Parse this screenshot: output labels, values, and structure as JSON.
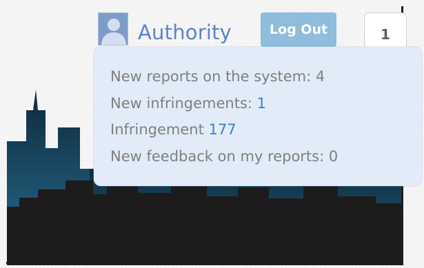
{
  "header": {
    "user_name": "Authority",
    "logout_label": "Log Out",
    "notification_count": "1"
  },
  "notifications": {
    "items": [
      {
        "label": "New reports on the system: ",
        "value": "4"
      },
      {
        "label": "New infringements: ",
        "value": "1"
      },
      {
        "label": "Infringement ",
        "value": "177"
      },
      {
        "label": "New feedback on my reports: ",
        "value": "0"
      }
    ]
  },
  "colors": {
    "skyline_dark": "#1d1b1b",
    "skyline_teal": "#27698c",
    "dropdown_bg": "#e1ecf8",
    "button_bg": "#8fbddb",
    "link": "#3e7ec3"
  }
}
